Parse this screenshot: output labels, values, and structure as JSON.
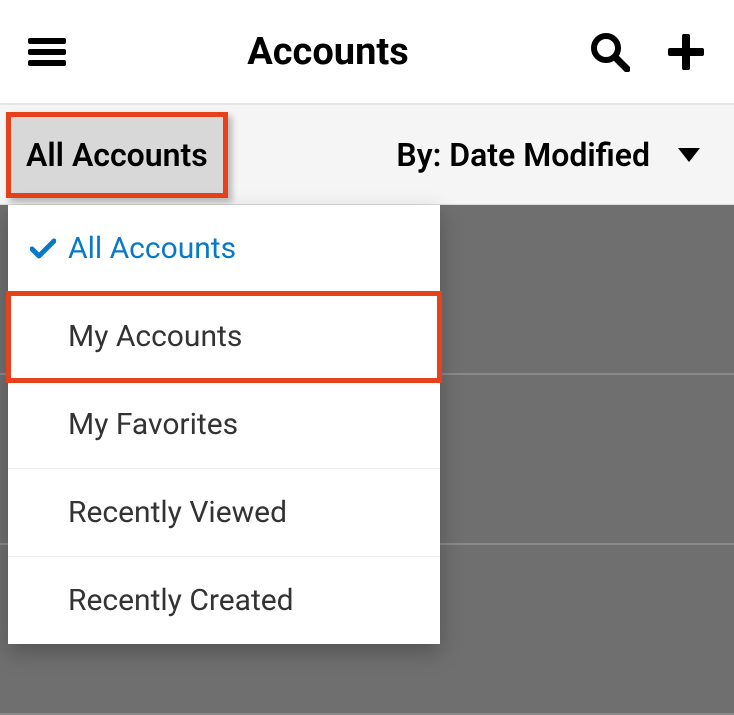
{
  "header": {
    "title": "Accounts"
  },
  "subheader": {
    "filter_label": "All Accounts",
    "sort_label": "By: Date Modified"
  },
  "filter_dropdown": {
    "items": [
      {
        "label": "All Accounts",
        "selected": true,
        "highlighted": false
      },
      {
        "label": "My Accounts",
        "selected": false,
        "highlighted": true
      },
      {
        "label": "My Favorites",
        "selected": false,
        "highlighted": false
      },
      {
        "label": "Recently Viewed",
        "selected": false,
        "highlighted": false
      },
      {
        "label": "Recently Created",
        "selected": false,
        "highlighted": false
      }
    ]
  }
}
